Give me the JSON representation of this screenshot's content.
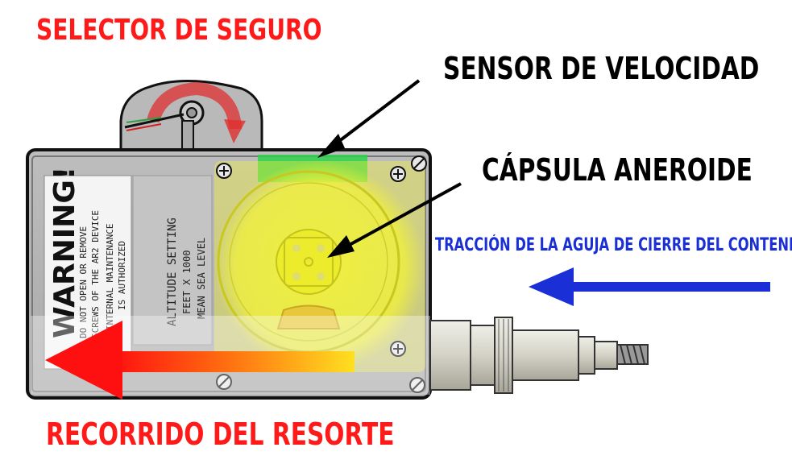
{
  "labels": {
    "selector": "SELECTOR DE SEGURO",
    "sensor": "SENSOR DE VELOCIDAD",
    "capsula": "CÁPSULA ANEROIDE",
    "traccion": "TRACCIÓN DE LA AGUJA DE CIERRE DEL CONTENEDOR",
    "recorrido": "RECORRIDO DEL RESORTE"
  },
  "device_text": {
    "warning_title": "WARNING!",
    "warning_line1": "DO NOT OPEN OR REMOVE",
    "warning_line2": "SCREWS OF THE AR2 DEVICE",
    "warning_line3": "INTERNAL MAINTENANCE",
    "warning_line4": "IS AUTHORIZED",
    "altitude_title": "ALTITUDE SETTING",
    "altitude_line2": "FEET X 1000",
    "altitude_line3": "MEAN SEA LEVEL"
  },
  "colors": {
    "label_red": "#ff1a1a",
    "label_black": "#000000",
    "label_blue": "#1a2fd6",
    "sensor_highlight": "#2fd14a",
    "capsule_highlight": "#f2f23a",
    "spring_arrow_start": "#ff1010",
    "spring_arrow_end": "#ffe020",
    "pull_arrow": "#1a2fd6",
    "selector_arrow": "#e03030"
  },
  "icons": {
    "screw": "screw-icon"
  }
}
